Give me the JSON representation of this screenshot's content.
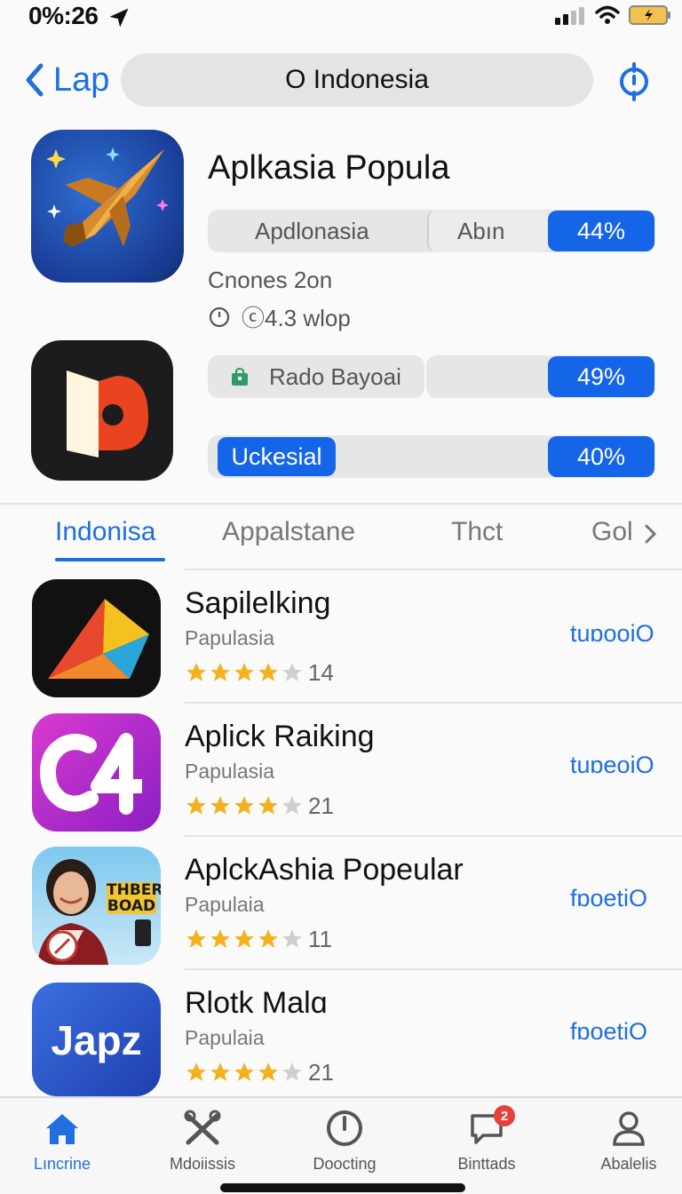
{
  "status_bar": {
    "time": "0%:26",
    "icons": [
      "location-arrow-icon",
      "cellular-signal-icon",
      "wifi-icon",
      "battery-icon"
    ]
  },
  "nav": {
    "back_label": "Lap",
    "search_text": "O Indonesia",
    "icons": [
      "chevron-left-icon",
      "target-icon"
    ]
  },
  "featured": {
    "title": "Aplkasia Popula",
    "row1": {
      "left": "Apdlonasia",
      "middle": "Abın",
      "percent": "44%"
    },
    "meta_line1": "Cnones 2on",
    "meta_line2": "ⓒ4.3 wlop",
    "row2": {
      "left": "Rado Bayoai",
      "percent": "49%"
    },
    "row3": {
      "left": "Uckesial",
      "percent": "40%"
    }
  },
  "tabs": {
    "items": [
      "Indonisa",
      "Appalstane",
      "Thct",
      "Gol"
    ],
    "active_index": 0
  },
  "apps": [
    {
      "name": "Sapilelking",
      "subtitle": "Papulasia",
      "stars": 4,
      "rating_count": "14",
      "action": "tuɒooiO",
      "icon": "prism-icon"
    },
    {
      "name": "Aplick Raiking",
      "subtitle": "Papulasia",
      "stars": 4,
      "rating_count": "21",
      "action": "tuɒeoiO",
      "icon": "c4-logo-icon"
    },
    {
      "name": "AplckAshia Popeular",
      "subtitle": "Papulaia",
      "stars": 4,
      "rating_count": "11",
      "action": "fɒoetiO",
      "icon": "avatar-photo-icon",
      "icon_text": "THBER BOAD"
    },
    {
      "name": "Rlotk Malɑ",
      "subtitle": "Papulaia",
      "stars": 4,
      "rating_count": "21",
      "action": "fɒoetiO",
      "icon": "japz-logo-icon",
      "icon_text": "Japz"
    }
  ],
  "tab_bar": [
    {
      "label": "Lıncrine",
      "icon": "home-icon",
      "active": true
    },
    {
      "label": "Mdoiissis",
      "icon": "tools-icon",
      "active": false
    },
    {
      "label": "Doocting",
      "icon": "clock-icon",
      "active": false
    },
    {
      "label": "Binttads",
      "icon": "chat-icon",
      "active": false,
      "badge": "2"
    },
    {
      "label": "Abalelis",
      "icon": "person-icon",
      "active": false
    }
  ],
  "colors": {
    "accent": "#1f6fe0",
    "pill_blue": "#1465e8",
    "star": "#f5b01e",
    "badge": "#e8413b"
  }
}
